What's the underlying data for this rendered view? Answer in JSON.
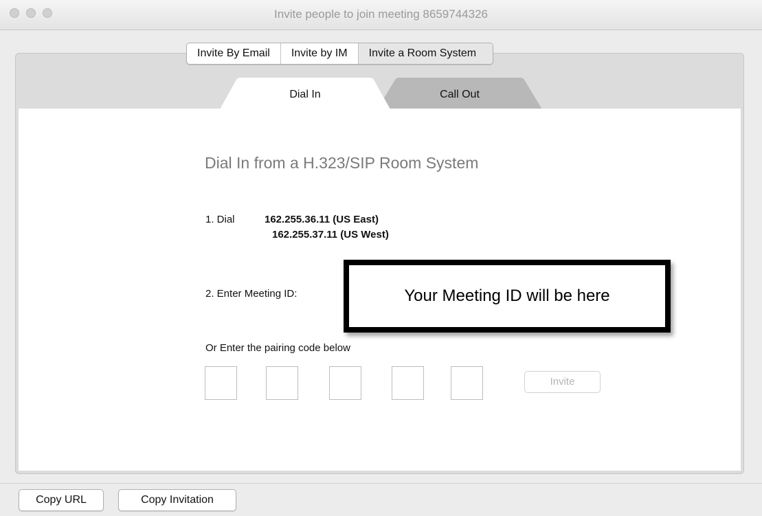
{
  "window": {
    "title": "Invite people to join meeting 8659744326"
  },
  "invite_tabs": [
    {
      "label": "Invite By Email"
    },
    {
      "label": "Invite by IM"
    },
    {
      "label": "Invite a Room System",
      "selected": true
    }
  ],
  "sub_tabs": [
    {
      "label": "Dial In",
      "active": true
    },
    {
      "label": "Call Out",
      "active": false
    }
  ],
  "dial_in": {
    "heading": "Dial In from a H.323/SIP Room System",
    "step1_label": "1. Dial",
    "addresses": [
      "162.255.36.11 (US East)",
      "162.255.37.11 (US West)"
    ],
    "step2_label": "2. Enter Meeting ID:",
    "meeting_id_placeholder": "Your Meeting ID will be here",
    "pairing_label": "Or Enter the pairing code below",
    "pairing_code": [
      "",
      "",
      "",
      "",
      ""
    ],
    "invite_label": "Invite"
  },
  "footer": {
    "copy_url": "Copy URL",
    "copy_invitation": "Copy Invitation"
  },
  "colors": {
    "window_bg": "#ececec",
    "panel_bg": "#dcdcdc",
    "active_tab_bg": "#ffffff",
    "inactive_tab_bg": "#b8b8b8",
    "heading_gray": "#7a7a7a",
    "disabled_text": "#b4b4b4"
  },
  "icons": [
    "close-traffic-light",
    "minimize-traffic-light",
    "zoom-traffic-light"
  ]
}
